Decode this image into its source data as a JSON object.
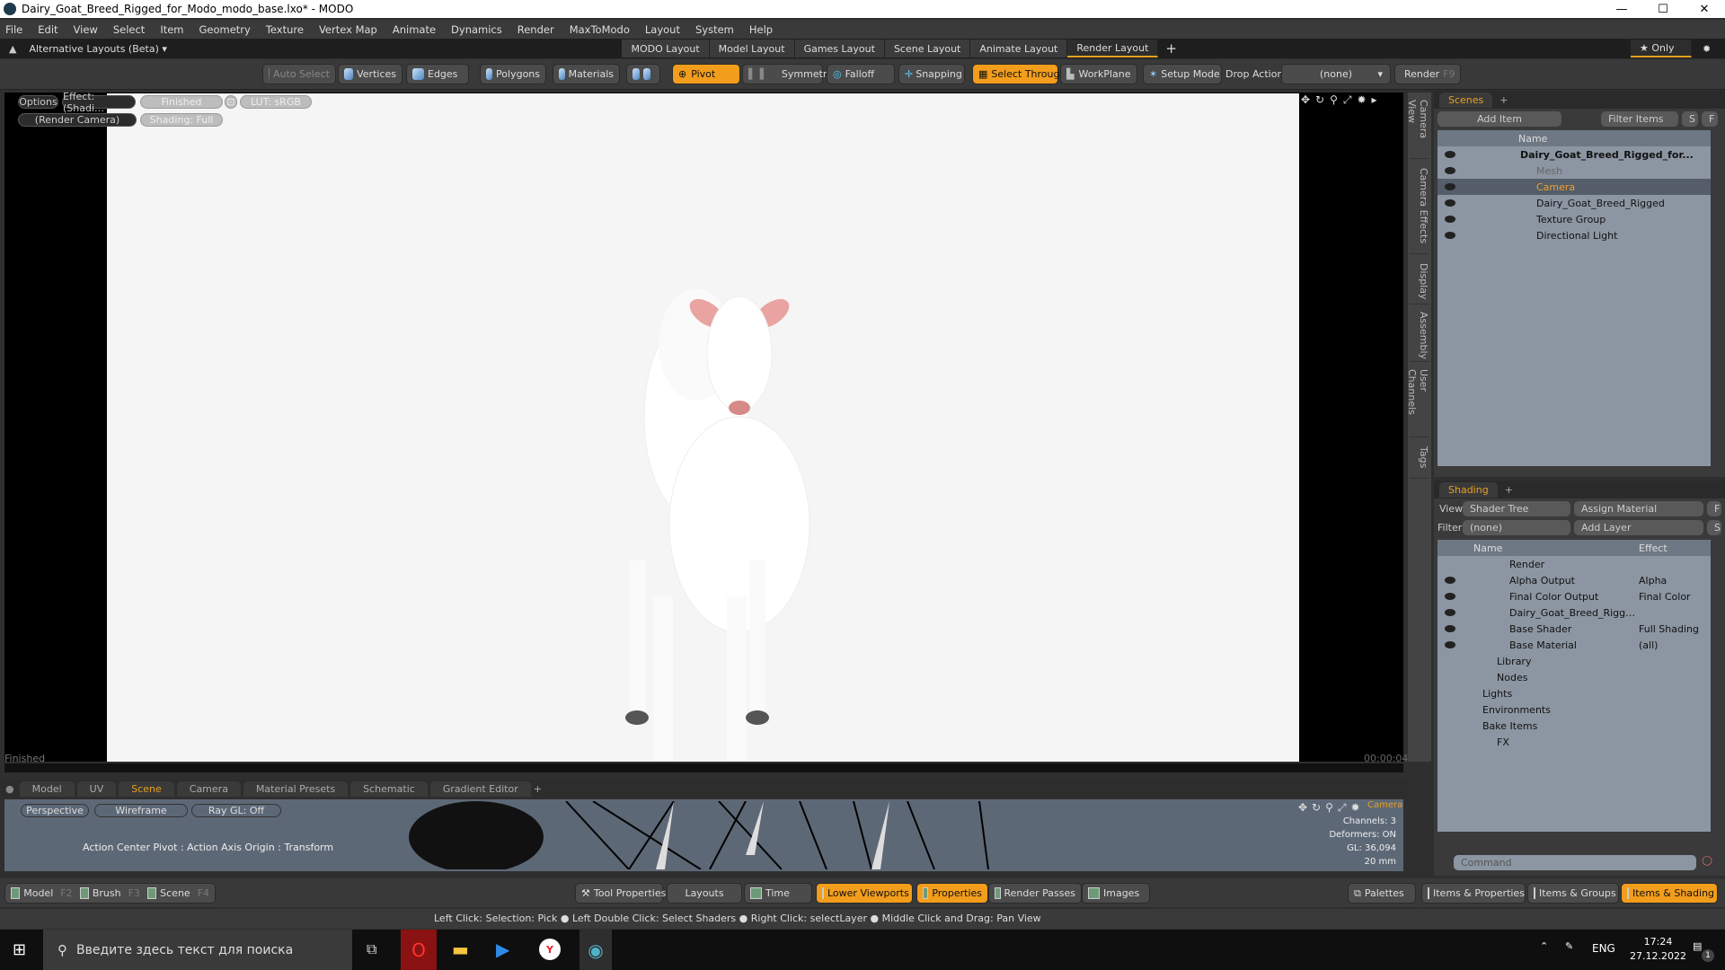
{
  "window": {
    "title": "Dairy_Goat_Breed_Rigged_for_Modo_modo_base.lxo* - MODO",
    "minimize": "—",
    "maximize": "☐",
    "close": "✕"
  },
  "menu": [
    "File",
    "Edit",
    "View",
    "Select",
    "Item",
    "Geometry",
    "Texture",
    "Vertex Map",
    "Animate",
    "Dynamics",
    "Render",
    "MaxToModo",
    "Layout",
    "System",
    "Help"
  ],
  "layoutbar": {
    "alt_layouts": "Alternative Layouts (Beta) ▾",
    "tabs": [
      "MODO Layout",
      "Model Layout",
      "Games Layout",
      "Scene Layout",
      "Animate Layout",
      "Render Layout"
    ],
    "active": "Render Layout",
    "add": "+",
    "only": "★ Only"
  },
  "toolbar": {
    "auto_select": "Auto Select",
    "vertices": "Vertices",
    "edges": "Edges",
    "polygons": "Polygons",
    "materials": "Materials",
    "pivot": "Pivot",
    "symmetry": "Symmetry",
    "falloff": "Falloff",
    "snapping": "Snapping",
    "select_through": "Select Through",
    "workplane": "WorkPlane",
    "setup_mode": "Setup Mode",
    "drop_action_label": "Drop Action",
    "drop_action_value": "(none)",
    "render": "Render",
    "render_key": "F9"
  },
  "viewport": {
    "options": "Options",
    "effect": "Effect: (Shadi…",
    "finished_pill": "Finished",
    "lut": "LUT: sRGB",
    "camera": "(Render Camera)",
    "shading": "Shading: Full",
    "status": "Finished",
    "time": "00:00:04"
  },
  "sidetabs": [
    "Camera View",
    "Camera Effects",
    "Display",
    "Assembly",
    "User Channels",
    "Tags"
  ],
  "scenes": {
    "tab": "Scenes",
    "add_item": "Add Item",
    "filter": "Filter Items",
    "s": "S",
    "f": "F",
    "col_name": "Name",
    "items": [
      {
        "name": "Dairy_Goat_Breed_Rigged_for...",
        "bold": true
      },
      {
        "name": "Mesh",
        "dim": true
      },
      {
        "name": "Camera",
        "selected": true
      },
      {
        "name": "Dairy_Goat_Breed_Rigged"
      },
      {
        "name": "Texture Group"
      },
      {
        "name": "Directional Light"
      }
    ]
  },
  "shading": {
    "tab": "Shading",
    "view_label": "View",
    "view_value": "Shader Tree",
    "assign": "Assign Material",
    "f": "F",
    "filter_label": "Filter",
    "filter_value": "(none)",
    "add_layer": "Add Layer",
    "s": "S",
    "col_name": "Name",
    "col_effect": "Effect",
    "items": [
      {
        "name": "Render",
        "effect": ""
      },
      {
        "name": "Alpha Output",
        "effect": "Alpha"
      },
      {
        "name": "Final Color Output",
        "effect": "Final Color"
      },
      {
        "name": "Dairy_Goat_Breed_Rigg…",
        "effect": ""
      },
      {
        "name": "Base Shader",
        "effect": "Full Shading"
      },
      {
        "name": "Base Material",
        "effect": "(all)"
      },
      {
        "name": "Library",
        "effect": ""
      },
      {
        "name": "Nodes",
        "effect": ""
      },
      {
        "name": "Lights",
        "effect": ""
      },
      {
        "name": "Environments",
        "effect": ""
      },
      {
        "name": "Bake Items",
        "effect": ""
      },
      {
        "name": "FX",
        "effect": ""
      }
    ],
    "command_placeholder": "Command"
  },
  "lower": {
    "tabs": [
      "Model",
      "UV",
      "Scene",
      "Camera",
      "Material Presets",
      "Schematic",
      "Gradient Editor"
    ],
    "active": "Scene",
    "perspective": "Perspective",
    "wireframe": "Wireframe",
    "raygl": "Ray GL: Off",
    "action_center": "Action Center Pivot : Action Axis Origin : Transform",
    "cam_label": "Camera",
    "stats": [
      "Channels: 3",
      "Deformers: ON",
      "GL: 36,094",
      "20 mm"
    ]
  },
  "bottom": {
    "left": [
      {
        "label": "Model",
        "key": "F2"
      },
      {
        "label": "Brush",
        "key": "F3"
      },
      {
        "label": "Scene",
        "key": "F4"
      }
    ],
    "tool_properties": "Tool Properties",
    "layouts": "Layouts",
    "time": "Time",
    "lower_viewports": "Lower Viewports",
    "properties": "Properties",
    "render_passes": "Render Passes",
    "images": "Images",
    "palettes": "Palettes",
    "items_properties": "Items & Properties",
    "items_groups": "Items & Groups",
    "items_shading": "Items & Shading"
  },
  "status": "Left Click: Selection: Pick ● Left Double Click: Select Shaders ● Right Click: selectLayer ● Middle Click and Drag: Pan View",
  "taskbar": {
    "search_placeholder": "Введите здесь текст для поиска",
    "lang": "ENG",
    "time": "17:24",
    "date": "27.12.2022",
    "notifications": "1"
  }
}
